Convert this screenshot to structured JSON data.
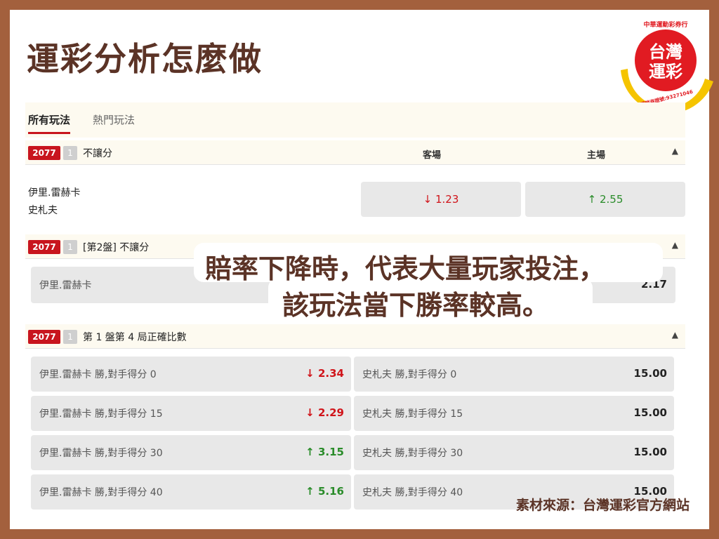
{
  "page_title": "運彩分析怎麼做",
  "logo": {
    "top_text": "中華運動彩券行",
    "line1": "台灣",
    "line2": "運彩",
    "bottom_text": "經銷商證號:93271046",
    "colors": {
      "red": "#e11b22",
      "yellow": "#f5c400"
    }
  },
  "tabs": [
    {
      "label": "所有玩法",
      "active": true
    },
    {
      "label": "熱門玩法",
      "active": false
    }
  ],
  "sections": [
    {
      "code": "2077",
      "num": "1",
      "title": "不讓分",
      "col_away": "客場",
      "col_home": "主場",
      "teams": [
        "伊里.雷赫卡",
        "史札夫"
      ],
      "odds_away": {
        "arrow": "↓",
        "value": "1.23",
        "trend": "down"
      },
      "odds_home": {
        "arrow": "↑",
        "value": "2.55",
        "trend": "up"
      }
    },
    {
      "code": "2077",
      "num": "1",
      "title": "[第2盤] 不讓分",
      "row_label": "伊里.雷赫卡",
      "row_value": "2.17"
    },
    {
      "code": "2077",
      "num": "1",
      "title": "第 1 盤第 4 局正確比數",
      "rows": [
        {
          "left_label": "伊里.雷赫卡 勝,對手得分 0",
          "left_arrow": "↓",
          "left_value": "2.34",
          "left_trend": "down",
          "right_label": "史札夫 勝,對手得分 0",
          "right_value": "15.00"
        },
        {
          "left_label": "伊里.雷赫卡 勝,對手得分 15",
          "left_arrow": "↓",
          "left_value": "2.29",
          "left_trend": "down",
          "right_label": "史札夫 勝,對手得分 15",
          "right_value": "15.00"
        },
        {
          "left_label": "伊里.雷赫卡 勝,對手得分 30",
          "left_arrow": "↑",
          "left_value": "3.15",
          "left_trend": "up",
          "right_label": "史札夫 勝,對手得分 30",
          "right_value": "15.00"
        },
        {
          "left_label": "伊里.雷赫卡 勝,對手得分 40",
          "left_arrow": "↑",
          "left_value": "5.16",
          "left_trend": "up",
          "right_label": "史札夫 勝,對手得分 40",
          "right_value": "15.00"
        }
      ]
    }
  ],
  "overlay": {
    "line1": "賠率下降時，代表大量玩家投注，",
    "line2": "該玩法當下勝率較高。"
  },
  "source": "素材來源：台灣運彩官方網站",
  "colors": {
    "brand_brown": "#5b3326",
    "frame": "#a3603d",
    "accent_red": "#c8151e",
    "down": "#d0141a",
    "up": "#2a8c2a"
  }
}
